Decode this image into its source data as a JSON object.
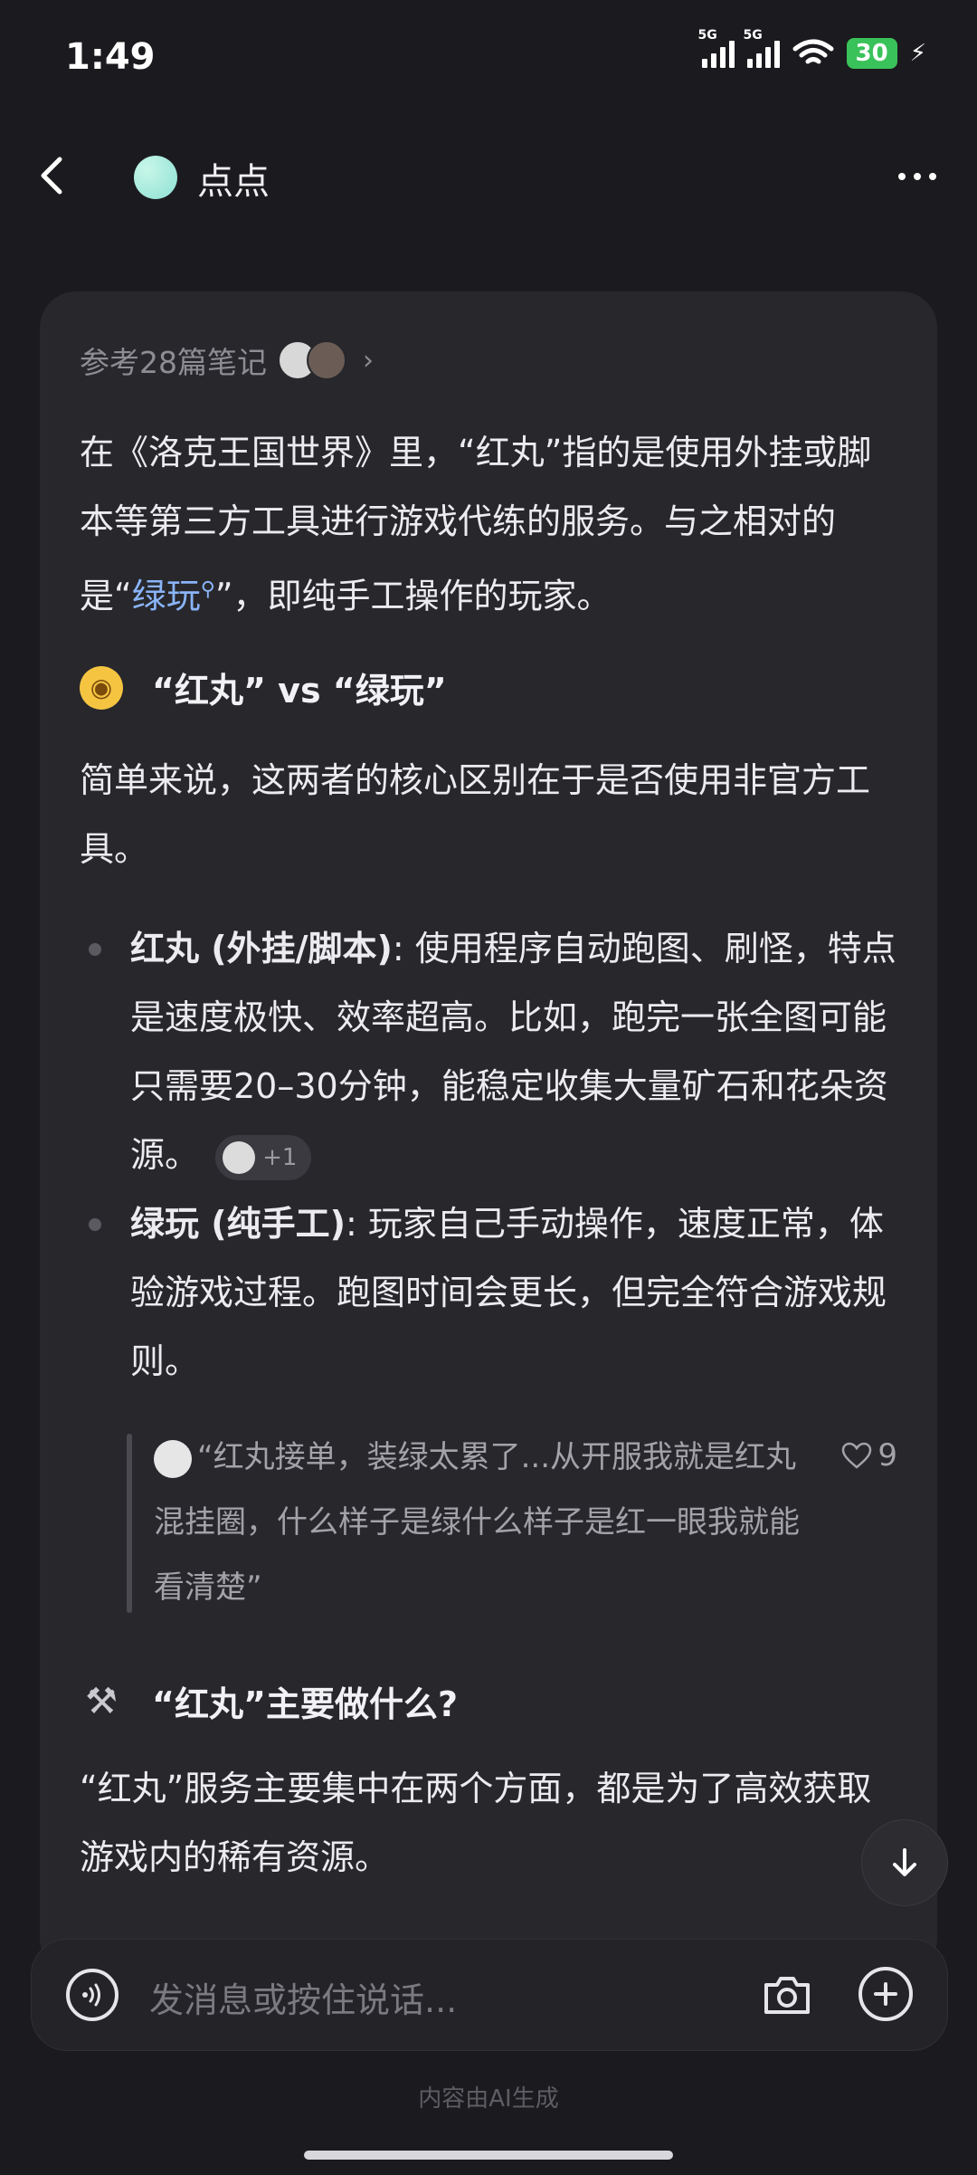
{
  "status_bar": {
    "time": "1:49",
    "network": "5G",
    "battery": "30"
  },
  "nav": {
    "title": "点点"
  },
  "card": {
    "references": "参考28篇笔记",
    "intro": {
      "p1": "在《洛克王国世界》里，“红丸”指的是使用外挂或脚本等第三方工具进行游戏代练的服务。与之相对的是“",
      "link": "绿玩",
      "p2": "”，即纯手工操作的玩家。"
    },
    "section1_heading": "“红丸” vs “绿玩”",
    "section1_intro": "简单来说，这两者的核心区别在于是否使用非官方工具。",
    "bullets": [
      {
        "term": "红丸 (外挂/脚本)",
        "text": ": 使用程序自动跑图、刷怪，特点是速度极快、效率超高。比如，跑完一张全图可能只需要20–30分钟，能稳定收集大量矿石和花朵资源。",
        "source_count": "+1"
      },
      {
        "term": "绿玩 (纯手工)",
        "text": ": 玩家自己手动操作，速度正常，体验游戏过程。跑图时间会更长，但完全符合游戏规则。"
      }
    ],
    "quote": {
      "text": "“红丸接单，装绿太累了...从开服我就是红丸混挂圈，什么样子是绿什么样子是红一眼我就能看清楚”",
      "likes": "9"
    },
    "section2_heading": "“红丸”主要做什么?",
    "section2_intro": "“红丸”服务主要集中在两个方面，都是为了高效获取游戏内的稀有资源。"
  },
  "input": {
    "placeholder": "发消息或按住说话..."
  },
  "footer": {
    "disclaimer": "内容由AI生成"
  }
}
